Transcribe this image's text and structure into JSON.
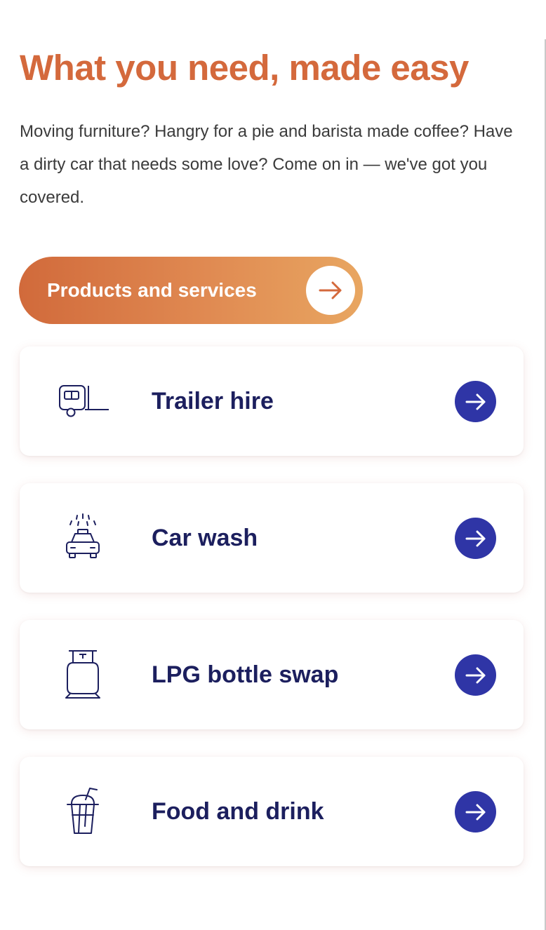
{
  "section": {
    "title": "What you need, made easy",
    "intro": "Moving furniture? Hangry for a pie and barista made coffee? Have a dirty car that needs some love? Come on in — we've got you covered."
  },
  "cta": {
    "label": "Products and services",
    "icon": "arrow-right-icon"
  },
  "services": [
    {
      "label": "Trailer hire",
      "icon": "trailer-icon",
      "arrow_icon": "arrow-right-icon"
    },
    {
      "label": "Car wash",
      "icon": "car-wash-icon",
      "arrow_icon": "arrow-right-icon"
    },
    {
      "label": "LPG bottle swap",
      "icon": "gas-bottle-icon",
      "arrow_icon": "arrow-right-icon"
    },
    {
      "label": "Food and drink",
      "icon": "drink-cup-icon",
      "arrow_icon": "arrow-right-icon"
    }
  ],
  "colors": {
    "heading": "#d4693c",
    "body_text": "#3b3b3b",
    "cta_gradient_start": "#d16a3b",
    "cta_gradient_end": "#e8a661",
    "card_label": "#1c1f5e",
    "card_arrow_bg": "#2f35a6",
    "icon_stroke": "#1c1f5e"
  }
}
